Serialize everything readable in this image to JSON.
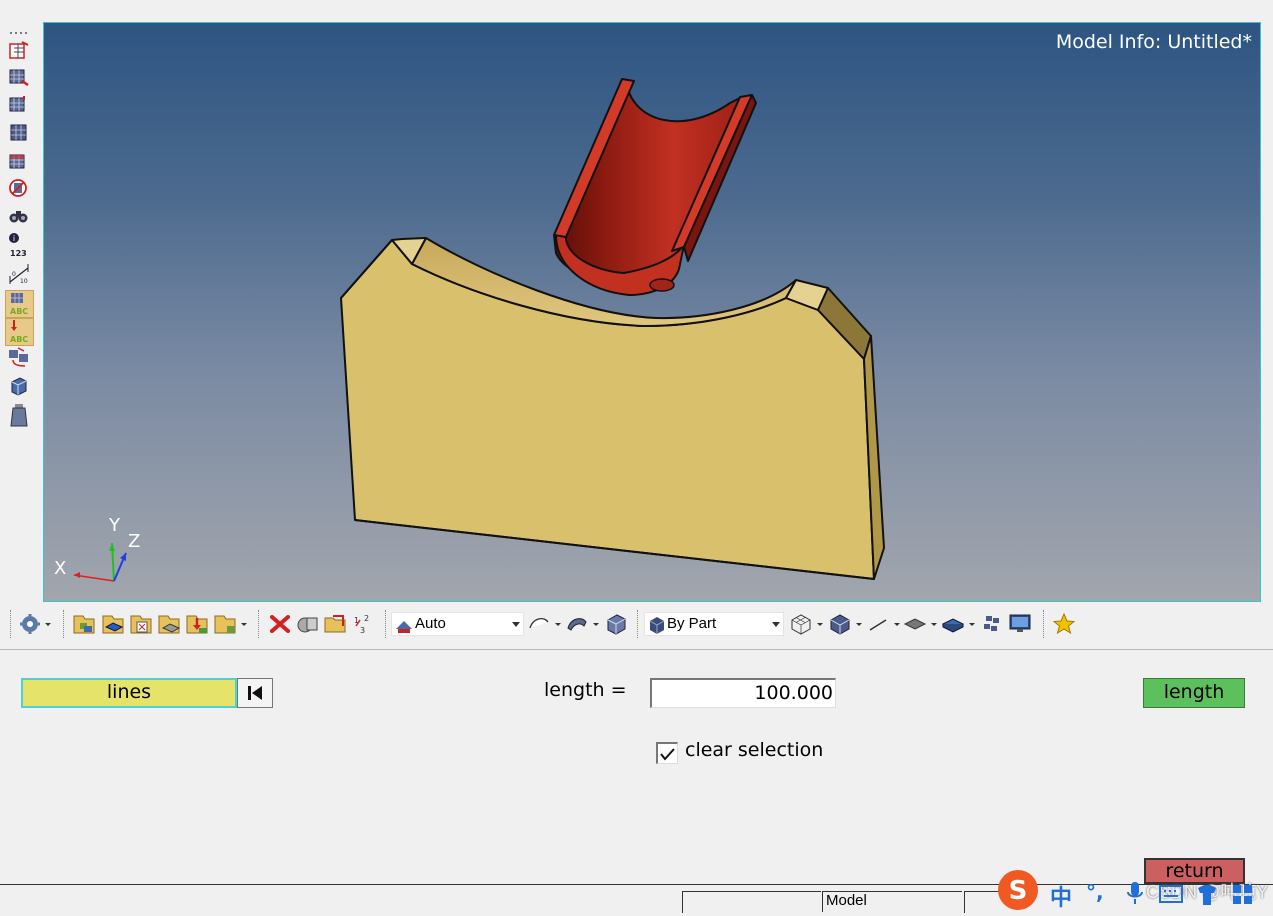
{
  "viewport": {
    "model_info": "Model Info: Untitled*",
    "axes": {
      "x": "X",
      "y": "Y",
      "z": "Z"
    },
    "colors": {
      "bg_top": "#2d5582",
      "bg_bottom": "#a2a6ad",
      "block": "#d8c06c",
      "tube": "#b02418"
    }
  },
  "toolbar": {
    "display_mode": "Auto",
    "color_mode": "By Part"
  },
  "panel": {
    "lines_label": "lines",
    "length_label": "length =",
    "length_value": "100.000",
    "length_button": "length",
    "clear_selection_label": "clear selection",
    "clear_selection_checked": true,
    "return_label": "return"
  },
  "statusbar": {
    "model_label": "Model",
    "watermark": "CSDN @吨吨Y"
  },
  "ime": {
    "brand_glyph": "S",
    "lang": "中",
    "punct": "°,"
  },
  "icons": [
    "grip-icon",
    "page-icon",
    "mesh-icon",
    "organize-icon",
    "orient-icon",
    "find-icon",
    "info-icon",
    "measure-icon",
    "label-icon",
    "transform-icon",
    "cube-icon",
    "weight-icon",
    "delete-icon",
    "star-icon",
    "monitor-icon",
    "microphone-icon",
    "keyboard-icon",
    "shirt-icon",
    "grid-icon"
  ]
}
